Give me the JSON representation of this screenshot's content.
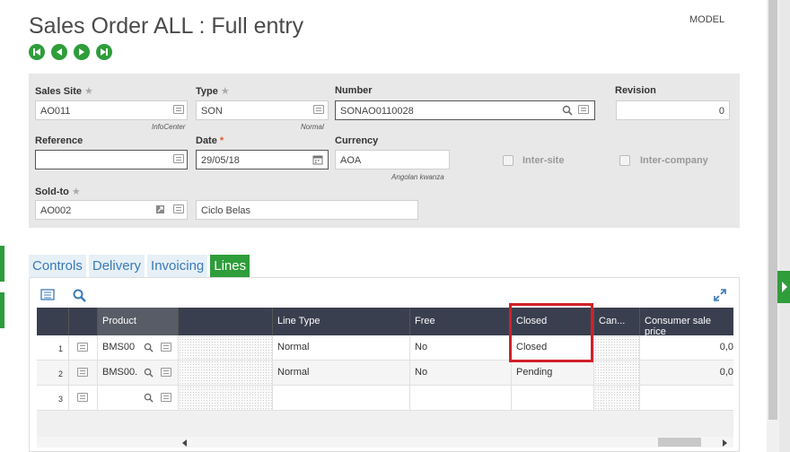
{
  "header": {
    "title": "Sales Order ALL : Full entry",
    "model": "MODEL"
  },
  "colors": {
    "accent": "#2e9d3a",
    "grid_header": "#3a3f4f",
    "highlight": "#d0202a",
    "tab_text": "#3a7ab8"
  },
  "form": {
    "sales_site": {
      "label": "Sales Site",
      "value": "AO011",
      "sub": "InfoCenter"
    },
    "type": {
      "label": "Type",
      "value": "SON",
      "sub": "Normal"
    },
    "number": {
      "label": "Number",
      "value": "SONAO0110028"
    },
    "revision": {
      "label": "Revision",
      "value": "0"
    },
    "reference": {
      "label": "Reference",
      "value": ""
    },
    "date": {
      "label": "Date",
      "value": "29/05/18"
    },
    "currency": {
      "label": "Currency",
      "value": "AOA",
      "sub": "Angolan kwanza"
    },
    "inter_site": {
      "label": "Inter-site",
      "checked": false
    },
    "inter_company": {
      "label": "Inter-company",
      "checked": false
    },
    "sold_to": {
      "label": "Sold-to",
      "value": "AO002",
      "name": "Ciclo Belas"
    }
  },
  "tabs": [
    {
      "label": "Controls",
      "active": false
    },
    {
      "label": "Delivery",
      "active": false
    },
    {
      "label": "Invoicing",
      "active": false
    },
    {
      "label": "Lines",
      "active": true
    }
  ],
  "grid": {
    "columns": {
      "product": "Product",
      "line_type": "Line Type",
      "free": "Free",
      "closed": "Closed",
      "can": "Can...",
      "consumer_price": "Consumer sale price"
    },
    "rows": [
      {
        "num": "1",
        "product": "BMS00",
        "line_type": "Normal",
        "free": "No",
        "closed": "Closed",
        "price": "0,0"
      },
      {
        "num": "2",
        "product": "BMS00.",
        "line_type": "Normal",
        "free": "No",
        "closed": "Pending",
        "price": "0,0"
      },
      {
        "num": "3",
        "product": "",
        "line_type": "",
        "free": "",
        "closed": "",
        "price": ""
      }
    ]
  }
}
